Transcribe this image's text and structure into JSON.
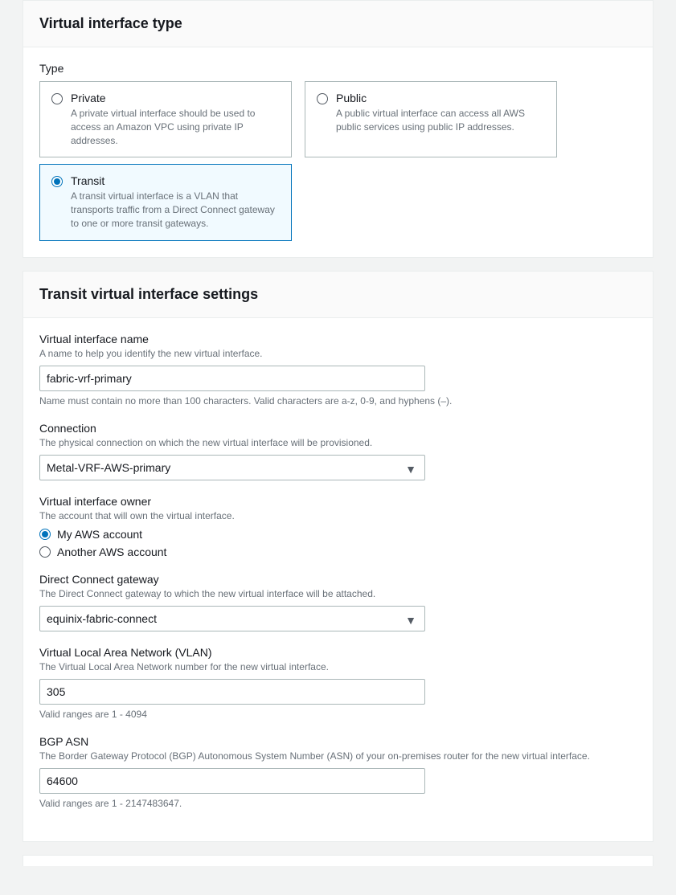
{
  "type_panel": {
    "title": "Virtual interface type",
    "type_label": "Type",
    "options": {
      "private": {
        "title": "Private",
        "desc": "A private virtual interface should be used to access an Amazon VPC using private IP addresses."
      },
      "public": {
        "title": "Public",
        "desc": "A public virtual interface can access all AWS public services using public IP addresses."
      },
      "transit": {
        "title": "Transit",
        "desc": "A transit virtual interface is a VLAN that transports traffic from a Direct Connect gateway to one or more transit gateways."
      }
    }
  },
  "settings_panel": {
    "title": "Transit virtual interface settings",
    "name": {
      "label": "Virtual interface name",
      "desc": "A name to help you identify the new virtual interface.",
      "value": "fabric-vrf-primary",
      "hint": "Name must contain no more than 100 characters. Valid characters are a-z, 0-9, and hyphens (–)."
    },
    "connection": {
      "label": "Connection",
      "desc": "The physical connection on which the new virtual interface will be provisioned.",
      "value": "Metal-VRF-AWS-primary"
    },
    "owner": {
      "label": "Virtual interface owner",
      "desc": "The account that will own the virtual interface.",
      "opt1": "My AWS account",
      "opt2": "Another AWS account"
    },
    "dxgw": {
      "label": "Direct Connect gateway",
      "desc": "The Direct Connect gateway to which the new virtual interface will be attached.",
      "value": "equinix-fabric-connect"
    },
    "vlan": {
      "label": "Virtual Local Area Network (VLAN)",
      "desc": "The Virtual Local Area Network number for the new virtual interface.",
      "value": "305",
      "hint": "Valid ranges are 1 - 4094"
    },
    "bgp": {
      "label": "BGP ASN",
      "desc": "The Border Gateway Protocol (BGP) Autonomous System Number (ASN) of your on-premises router for the new virtual interface.",
      "value": "64600",
      "hint": "Valid ranges are 1 - 2147483647."
    }
  }
}
